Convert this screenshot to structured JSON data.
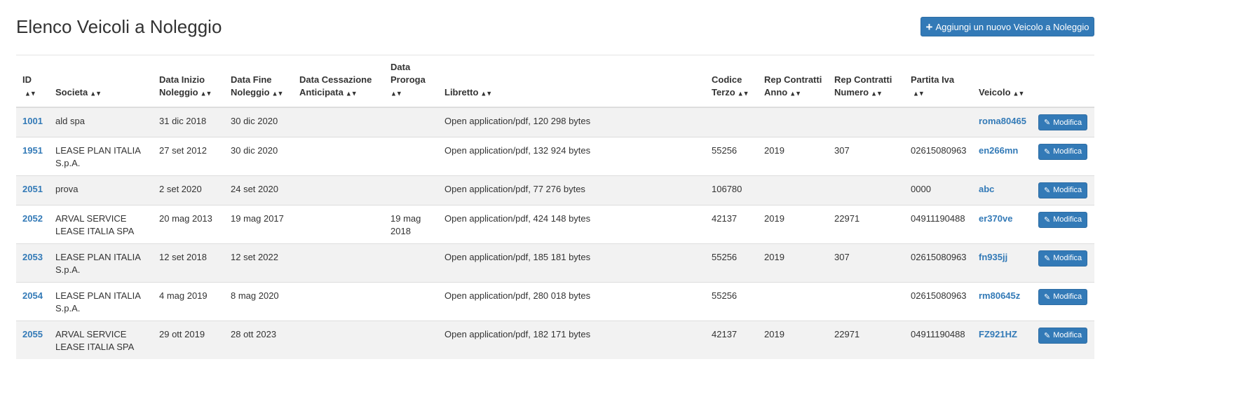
{
  "page": {
    "title": "Elenco Veicoli a Noleggio",
    "add_button_label": "Aggiungi un nuovo Veicolo a Noleggio",
    "add_icon": "plus-icon"
  },
  "colors": {
    "accent": "#337ab7",
    "stripe": "#f2f2f2",
    "border": "#dddddd"
  },
  "table": {
    "headers": {
      "id": "ID",
      "societa": "Societa",
      "inizio_l1": "Data Inizio",
      "inizio_l2": "Noleggio",
      "fine_l1": "Data Fine",
      "fine_l2": "Noleggio",
      "cess_l1": "Data Cessazione",
      "cess_l2": "Anticipata",
      "proroga_l1": "Data",
      "proroga_l2": "Proroga",
      "libretto": "Libretto",
      "codice_l1": "Codice",
      "codice_l2": "Terzo",
      "rep_anno_l1": "Rep Contratti",
      "rep_anno_l2": "Anno",
      "rep_num_l1": "Rep Contratti",
      "rep_num_l2": "Numero",
      "piva": "Partita Iva",
      "veicolo": "Veicolo"
    },
    "sort_icon": "sort-icon",
    "edit_label": "Modifica",
    "edit_icon": "pencil-icon",
    "rows": [
      {
        "id": "1001",
        "societa_l1": "ald spa",
        "societa_l2": "",
        "inizio": "31 dic 2018",
        "fine": "30 dic 2020",
        "cessazione": "",
        "proroga_l1": "",
        "proroga_l2": "",
        "libretto": "Open application/pdf, 120 298 bytes",
        "codice": "",
        "rep_anno": "",
        "rep_numero": "",
        "piva": "",
        "veicolo": "roma80465"
      },
      {
        "id": "1951",
        "societa_l1": "LEASE PLAN ITALIA",
        "societa_l2": "S.p.A.",
        "inizio": "27 set 2012",
        "fine": "30 dic 2020",
        "cessazione": "",
        "proroga_l1": "",
        "proroga_l2": "",
        "libretto": "Open application/pdf, 132 924 bytes",
        "codice": "55256",
        "rep_anno": "2019",
        "rep_numero": "307",
        "piva": "02615080963",
        "veicolo": "en266mn"
      },
      {
        "id": "2051",
        "societa_l1": "prova",
        "societa_l2": "",
        "inizio": "2 set 2020",
        "fine": "24 set 2020",
        "cessazione": "",
        "proroga_l1": "",
        "proroga_l2": "",
        "libretto": "Open application/pdf, 77 276 bytes",
        "codice": "106780",
        "rep_anno": "",
        "rep_numero": "",
        "piva": "0000",
        "veicolo": "abc"
      },
      {
        "id": "2052",
        "societa_l1": "ARVAL SERVICE",
        "societa_l2": "LEASE ITALIA SPA",
        "inizio": "20 mag 2013",
        "fine": "19 mag 2017",
        "cessazione": "",
        "proroga_l1": "19 mag",
        "proroga_l2": "2018",
        "libretto": "Open application/pdf, 424 148 bytes",
        "codice": "42137",
        "rep_anno": "2019",
        "rep_numero": "22971",
        "piva": "04911190488",
        "veicolo": "er370ve"
      },
      {
        "id": "2053",
        "societa_l1": "LEASE PLAN ITALIA",
        "societa_l2": "S.p.A.",
        "inizio": "12 set 2018",
        "fine": "12 set 2022",
        "cessazione": "",
        "proroga_l1": "",
        "proroga_l2": "",
        "libretto": "Open application/pdf, 185 181 bytes",
        "codice": "55256",
        "rep_anno": "2019",
        "rep_numero": "307",
        "piva": "02615080963",
        "veicolo": "fn935jj"
      },
      {
        "id": "2054",
        "societa_l1": "LEASE PLAN ITALIA",
        "societa_l2": "S.p.A.",
        "inizio": "4 mag 2019",
        "fine": "8 mag 2020",
        "cessazione": "",
        "proroga_l1": "",
        "proroga_l2": "",
        "libretto": "Open application/pdf, 280 018 bytes",
        "codice": "55256",
        "rep_anno": "",
        "rep_numero": "",
        "piva": "02615080963",
        "veicolo": "rm80645z"
      },
      {
        "id": "2055",
        "societa_l1": "ARVAL SERVICE",
        "societa_l2": "LEASE ITALIA SPA",
        "inizio": "29 ott 2019",
        "fine": "28 ott 2023",
        "cessazione": "",
        "proroga_l1": "",
        "proroga_l2": "",
        "libretto": "Open application/pdf, 182 171 bytes",
        "codice": "42137",
        "rep_anno": "2019",
        "rep_numero": "22971",
        "piva": "04911190488",
        "veicolo": "FZ921HZ"
      }
    ]
  }
}
